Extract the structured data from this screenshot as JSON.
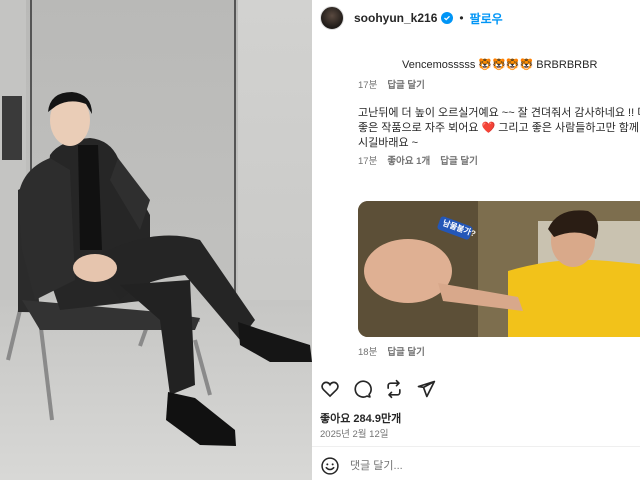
{
  "post": {
    "photo_alt": "man in dark suit seated on sling chair",
    "header": {
      "username": "soohyun_k216",
      "separator": "•",
      "follow_label": "팔로우"
    },
    "comments": [
      {
        "text": "Vencemosssss 🐯🐯🐯🐯 BRBRBRBR",
        "time": "17분",
        "reply_label": "답글 달기"
      },
      {
        "text": "고난뒤에 더 높이 오르실거예요 ~~ 잘 견뎌줘서 감사하네요 !! 더 좋은 작품으로 자주 뵈어요 ❤️ 그리고 좋은 사람들하고만 함께 하시길바래요 ~",
        "time": "17분",
        "likes": "좋아요 1개",
        "reply_label": "답글 달기"
      },
      {
        "image_text": "남물불가?",
        "time": "18분",
        "reply_label": "답글 달기"
      }
    ],
    "likes": "좋아요 284.9만개",
    "date": "2025년 2월 12일",
    "add_comment_placeholder": "댓글 달기...",
    "icons": {
      "like": "heart-icon",
      "comment": "comment-icon",
      "share": "repost-icon",
      "send": "send-icon",
      "emoji": "smiley-icon"
    },
    "colors": {
      "link_blue": "#0095f6",
      "text": "#262626",
      "muted": "#737373"
    }
  }
}
